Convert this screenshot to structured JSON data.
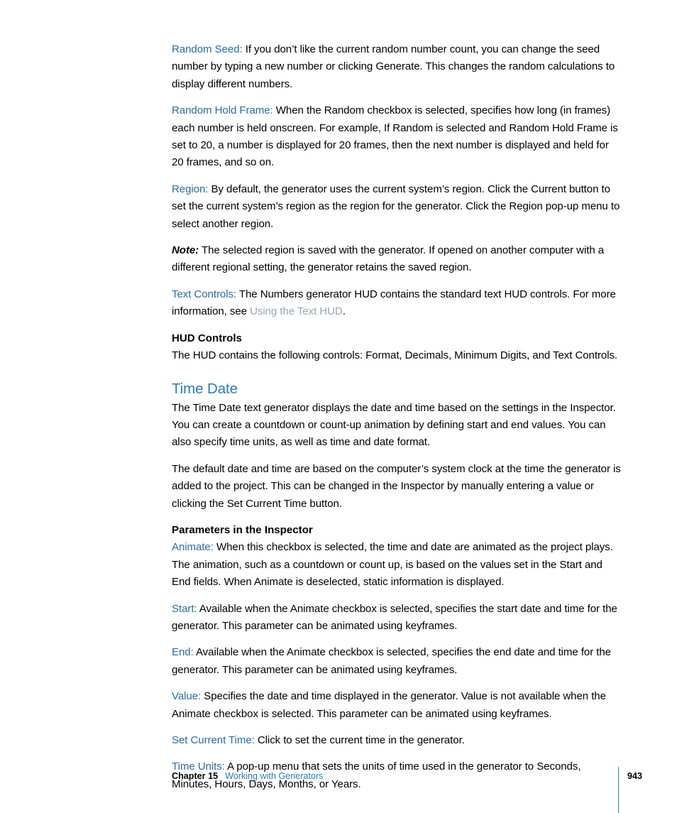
{
  "document": {
    "paragraphs": [
      {
        "term": "Random Seed:",
        "text": " If you don’t like the current random number count, you can change the seed number by typing a new number or clicking Generate. This changes the random calculations to display different numbers."
      },
      {
        "term": "Random Hold Frame:",
        "text": " When the Random checkbox is selected, specifies how long (in frames) each number is held onscreen. For example, If Random is selected and Random Hold Frame is set to 20, a number is displayed for 20 frames, then the next number is displayed and held for 20 frames, and so on."
      },
      {
        "term": "Region:",
        "text": " By default, the generator uses the current system’s region. Click the Current button to set the current system’s region as the region for the generator. Click the Region pop-up menu to select another region."
      },
      {
        "term": "Note:",
        "text": " The selected region is saved with the generator. If opened on another computer with a different regional setting, the generator retains the saved region."
      }
    ],
    "text_controls": {
      "term": "Text Controls:",
      "text_before": " The Numbers generator HUD contains the standard text HUD controls. For more information, see ",
      "link": "Using the Text HUD",
      "text_after": "."
    },
    "hud_controls": {
      "heading": "HUD Controls",
      "body": "The HUD contains the following controls: Format, Decimals, Minimum Digits, and Text Controls."
    },
    "time_date": {
      "heading": "Time Date",
      "paragraph1": "The Time Date text generator displays the date and time based on the settings in the Inspector. You can create a countdown or count-up animation by defining start and end values. You can also specify time units, as well as time and date format.",
      "paragraph2": "The default date and time are based on the computer’s system clock at the time the generator is added to the project. This can be changed in the Inspector by manually entering a value or clicking the Set Current Time button."
    },
    "parameters": {
      "heading": "Parameters in the Inspector",
      "items": [
        {
          "term": "Animate:",
          "text": " When this checkbox is selected, the time and date are animated as the project plays. The animation, such as a countdown or count up, is based on the values set in the Start and End fields. When Animate is deselected, static information is displayed."
        },
        {
          "term": "Start:",
          "text": " Available when the Animate checkbox is selected, specifies the start date and time for the generator. This parameter can be animated using keyframes."
        },
        {
          "term": "End:",
          "text": " Available when the Animate checkbox is selected, specifies the end date and time for the generator. This parameter can be animated using keyframes."
        },
        {
          "term": "Value:",
          "text": " Specifies the date and time displayed in the generator. Value is not available when the Animate checkbox is selected. This parameter can be animated using keyframes."
        },
        {
          "term": "Set Current Time:",
          "text": " Click to set the current time in the generator."
        },
        {
          "term": "Time Units:",
          "text": " A pop-up menu that sets the units of time used in the generator to Seconds, Minutes, Hours, Days, Months, or Years."
        }
      ]
    }
  },
  "footer": {
    "chapter": "Chapter 15",
    "title": "Working with Generators",
    "page_number": "943"
  }
}
